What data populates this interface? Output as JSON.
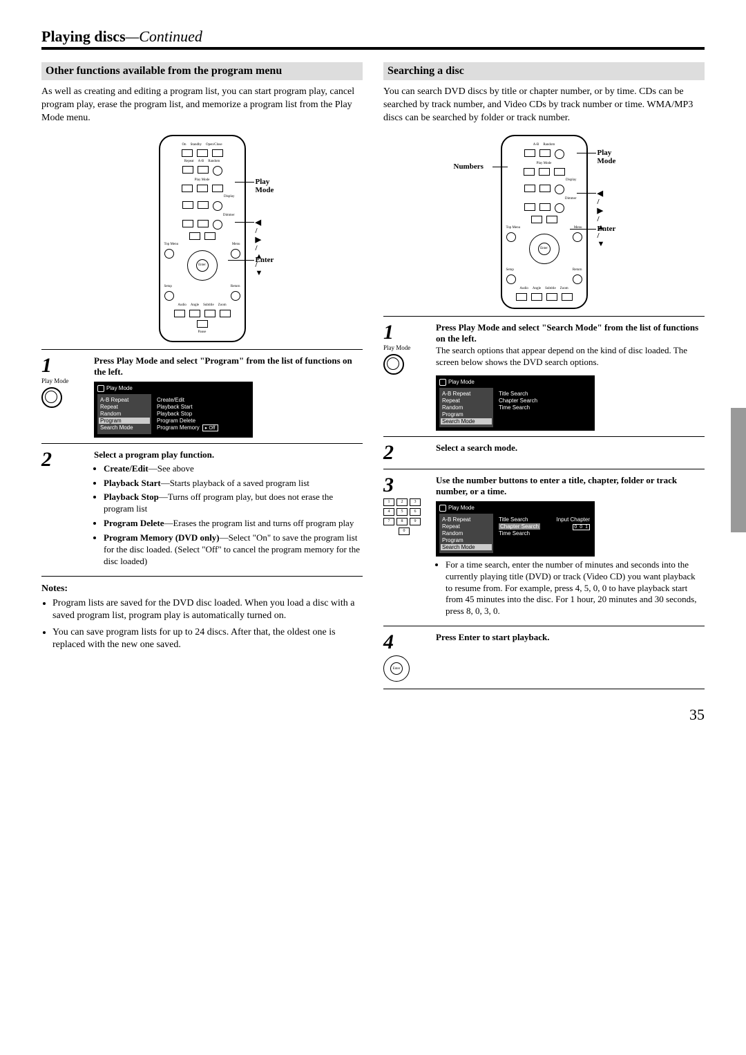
{
  "header": {
    "bold": "Playing discs",
    "sep": "—",
    "italic": "Continued"
  },
  "left": {
    "section": "Other functions available from the program menu",
    "intro": "As well as creating and editing a program list, you can start program play, cancel program play, erase the program list, and memorize a program list from the Play Mode menu.",
    "callouts": {
      "play_mode": "Play Mode",
      "arrows": "◀ / ▶ / ▲ / ▼",
      "enter": "Enter"
    },
    "step1": {
      "num": "1",
      "icon_label": "Play Mode",
      "head": "Press Play Mode and select \"Program\" from the list of functions on the left.",
      "osd": {
        "title": "Play Mode",
        "left": [
          "A-B Repeat",
          "Repeat",
          "Random",
          "Program",
          "Search Mode"
        ],
        "left_selected": "Program",
        "right": [
          "Create/Edit",
          "Playback Start",
          "Playback Stop",
          "Program Delete"
        ],
        "memory_label": "Program Memory",
        "memory_value": "Off"
      }
    },
    "step2": {
      "num": "2",
      "head": "Select a program play function.",
      "items": [
        {
          "b": "Create/Edit",
          "rest": "—See above"
        },
        {
          "b": "Playback Start",
          "rest": "—Starts playback of a saved program list"
        },
        {
          "b": "Playback Stop",
          "rest": "—Turns off program play, but does not erase the program list"
        },
        {
          "b": "Program Delete",
          "rest": "—Erases the program list and turns off program play"
        },
        {
          "b": "Program Memory (DVD only)",
          "rest": "—Select \"On\" to save the program list for the disc loaded. (Select \"Off\" to cancel the program memory for the disc loaded)"
        }
      ]
    },
    "notes_head": "Notes:",
    "notes": [
      "Program lists are saved for the DVD disc loaded. When you load a disc with a saved program list, program play is automatically turned on.",
      "You can save program lists for up to 24 discs. After that, the oldest one is replaced with the new one saved."
    ]
  },
  "right": {
    "section": "Searching a disc",
    "intro": "You can search DVD discs by title or chapter number, or by time. CDs can be searched by track number, and Video CDs by track number or time. WMA/MP3 discs can be searched by folder or track number.",
    "callouts": {
      "numbers": "Numbers",
      "play_mode": "Play Mode",
      "arrows": "◀ / ▶ / ▲ / ▼",
      "enter": "Enter"
    },
    "step1": {
      "num": "1",
      "icon_label": "Play Mode",
      "head": "Press Play Mode and select \"Search Mode\" from the list of functions on the left.",
      "body": "The search options that appear depend on the kind of disc loaded. The screen below shows the DVD search options.",
      "osd": {
        "title": "Play Mode",
        "left": [
          "A-B Repeat",
          "Repeat",
          "Random",
          "Program",
          "Search Mode"
        ],
        "left_selected": "Search Mode",
        "right": [
          "Title Search",
          "Chapter Search",
          "Time Search"
        ]
      }
    },
    "step2": {
      "num": "2",
      "head": "Select a search mode."
    },
    "step3": {
      "num": "3",
      "head": "Use the number buttons to enter a title, chapter, folder or track number, or a time.",
      "osd": {
        "title": "Play Mode",
        "left": [
          "A-B Repeat",
          "Repeat",
          "Random",
          "Program",
          "Search Mode"
        ],
        "left_selected": "Search Mode",
        "right": [
          "Title Search",
          "Chapter Search",
          "Time Search"
        ],
        "right_selected": "Chapter Search",
        "input_label": "Input Chapter",
        "input_value": "0 0 1"
      },
      "bullet": "For a time search, enter the number of minutes and seconds into the currently playing title (DVD) or track (Video CD) you want playback to resume from. For example, press 4, 5, 0, 0 to have playback start from 45 minutes into the disc. For 1 hour, 20 minutes and 30 seconds, press 8, 0, 3, 0."
    },
    "step4": {
      "num": "4",
      "head": "Press Enter to start playback."
    }
  },
  "page_number": "35",
  "remote_tiny": {
    "row0": [
      "On",
      "Standby",
      "Open/Close"
    ],
    "row1": [
      "Repeat",
      "A-B",
      "Random"
    ],
    "row1b": "Play Mode",
    "rowDisp": "Display",
    "rowDim": "Dimmer",
    "topmenu": "Top Menu",
    "menu": "Menu",
    "setup": "Setup",
    "return": "Return",
    "audio": "Audio",
    "angle": "Angle",
    "subtitle": "Subtitle",
    "zoom": "Zoom",
    "pause": "Pause",
    "enter": "Enter"
  }
}
